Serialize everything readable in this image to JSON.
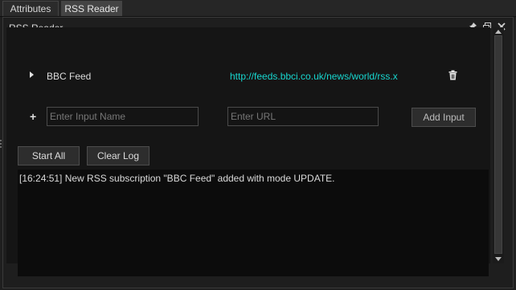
{
  "tabs": [
    {
      "label": "Attributes",
      "active": false
    },
    {
      "label": "RSS Reader",
      "active": true
    }
  ],
  "panel": {
    "title": "RSS Reader",
    "icons": [
      "pin-icon",
      "float-window-icon",
      "close-icon"
    ]
  },
  "feeds": [
    {
      "name": "BBC Feed",
      "url": "http://feeds.bbci.co.uk/news/world/rss.x"
    }
  ],
  "add_form": {
    "name_placeholder": "Enter Input Name",
    "url_placeholder": "Enter URL",
    "add_label": "Add Input"
  },
  "controls": {
    "start_all_label": "Start All",
    "clear_log_label": "Clear Log"
  },
  "log": {
    "lines": [
      "[16:24:51] New RSS subscription \"BBC Feed\" added with mode UPDATE."
    ]
  },
  "colors": {
    "accent_url": "#17d6cf",
    "background": "#1e1e1e",
    "log_background": "#0c0c0c"
  }
}
